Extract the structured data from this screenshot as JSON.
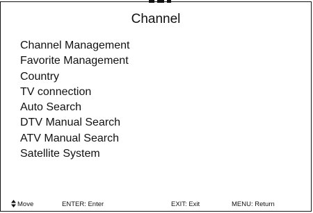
{
  "title": "Channel",
  "menu": {
    "items": [
      {
        "label": "Channel Management"
      },
      {
        "label": "Favorite Management"
      },
      {
        "label": "Country"
      },
      {
        "label": "TV connection"
      },
      {
        "label": "Auto Search"
      },
      {
        "label": "DTV Manual Search"
      },
      {
        "label": "ATV Manual Search"
      },
      {
        "label": "Satellite System"
      }
    ]
  },
  "footer": {
    "move_icon": "up-down-arrow-icon",
    "move_label": "Move",
    "enter_label": "ENTER: Enter",
    "exit_label": "EXIT: Exit",
    "menu_label": "MENU: Return"
  },
  "colors": {
    "text": "#111111",
    "background": "#ffffff",
    "border": "#111111"
  }
}
